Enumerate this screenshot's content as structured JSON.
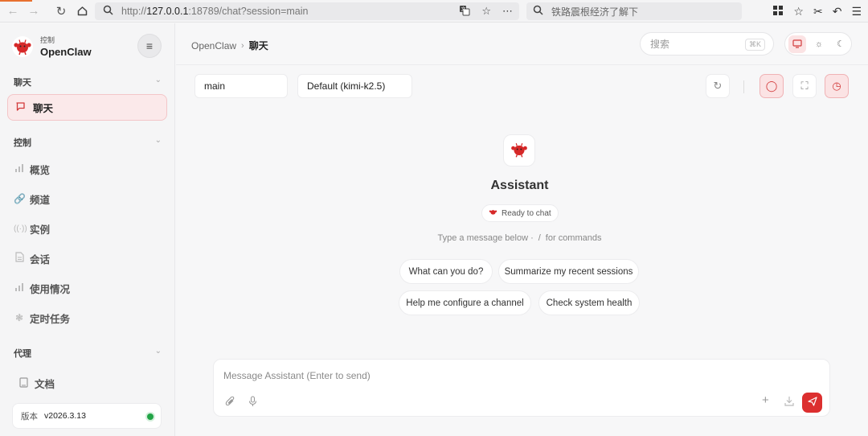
{
  "browser": {
    "url_prefix": "http://",
    "url_host": "127.0.0.1",
    "url_rest": ":18789/chat?session=main",
    "search_text": "铁路震根经济了解下"
  },
  "sidebar": {
    "brand_sub": "控制",
    "brand_name": "OpenClaw",
    "section_chat": "聊天",
    "active_item": "聊天",
    "section_control": "控制",
    "items": [
      {
        "label": "概览",
        "icon": "bar-chart-icon"
      },
      {
        "label": "频道",
        "icon": "link-icon"
      },
      {
        "label": "实例",
        "icon": "radio-icon"
      },
      {
        "label": "会话",
        "icon": "document-icon"
      },
      {
        "label": "使用情况",
        "icon": "bar-chart-icon"
      },
      {
        "label": "定时任务",
        "icon": "loader-icon"
      }
    ],
    "section_agent": "代理",
    "docs": "文档",
    "version_label": "版本",
    "version_value": "v2026.3.13",
    "status_color": "#22a447"
  },
  "header": {
    "crumb_root": "OpenClaw",
    "crumb_current": "聊天",
    "search_placeholder": "搜索",
    "search_shortcut": "⌘K"
  },
  "toolbar": {
    "session": "main",
    "model": "Default (kimi-k2.5)"
  },
  "hero": {
    "title": "Assistant",
    "status": "Ready to chat",
    "hint_before": "Type a message below ·",
    "hint_key": "/",
    "hint_after": "for commands"
  },
  "suggestions": [
    "What can you do?",
    "Summarize my recent sessions",
    "Help me configure a channel",
    "Check system health"
  ],
  "composer": {
    "placeholder": "Message Assistant (Enter to send)"
  },
  "colors": {
    "accent": "#dc2f2f",
    "accent_soft": "#fbe3e4"
  }
}
